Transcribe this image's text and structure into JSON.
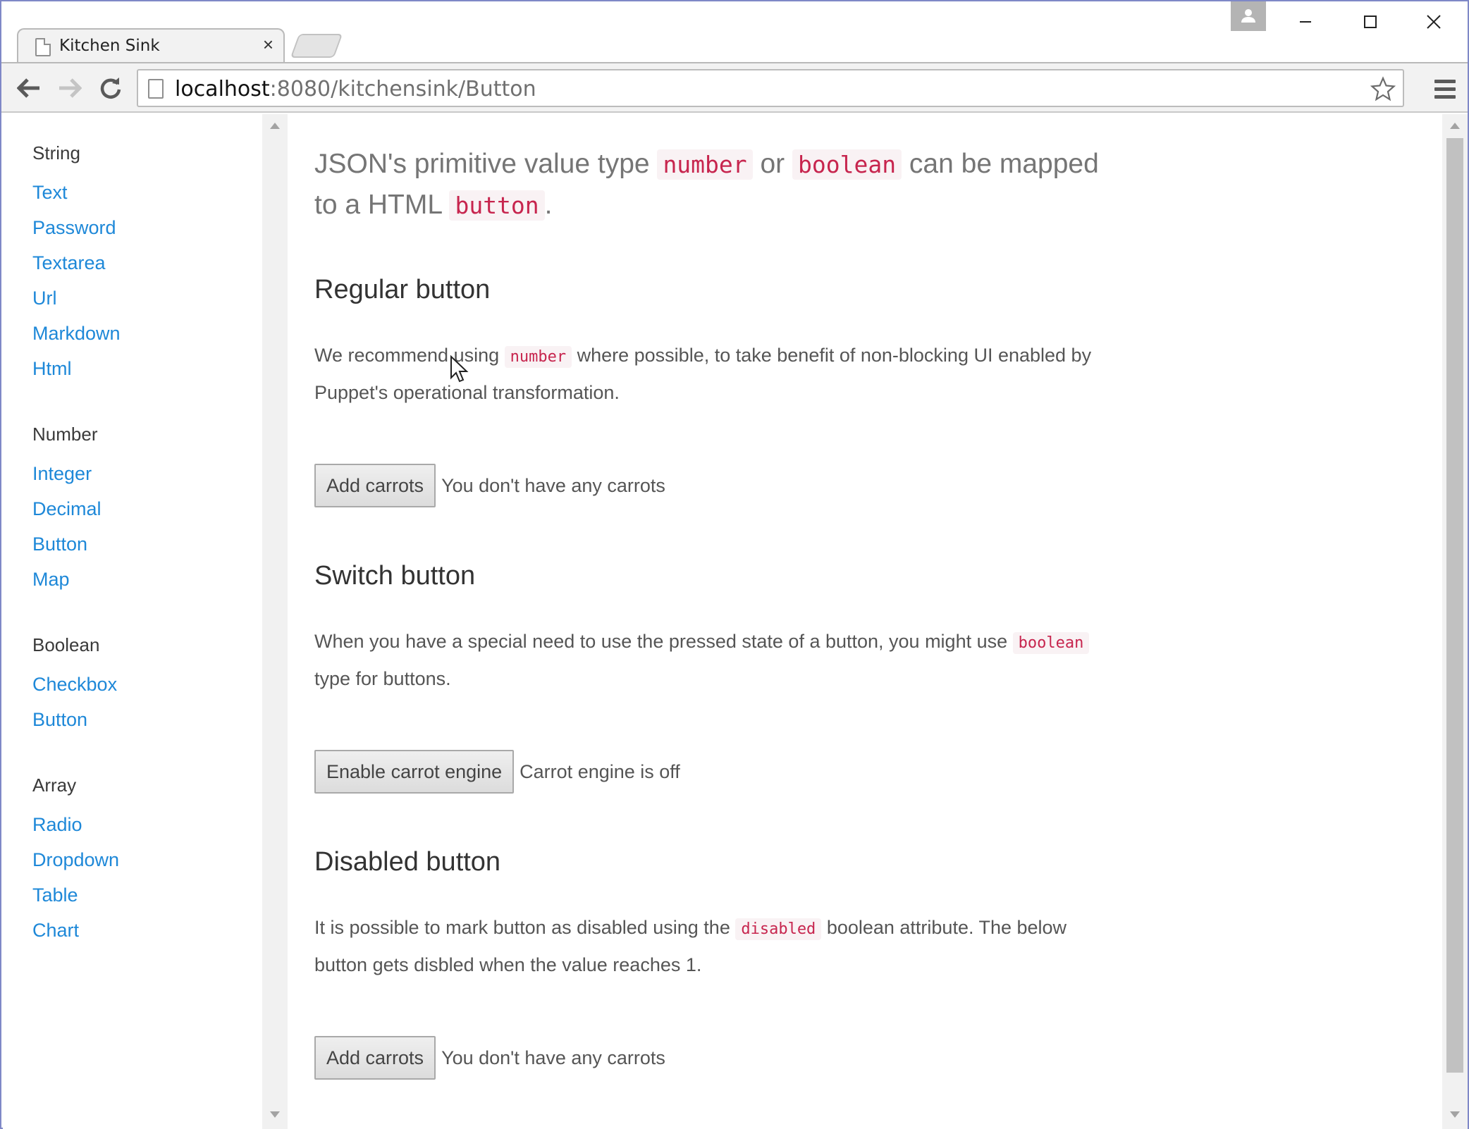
{
  "browser": {
    "tab_title": "Kitchen Sink",
    "tab_close": "×",
    "url_host": "localhost",
    "url_rest": ":8080/kitchensink/Button"
  },
  "sidebar": {
    "groups": [
      {
        "heading": "String",
        "items": [
          "Text",
          "Password",
          "Textarea",
          "Url",
          "Markdown",
          "Html"
        ]
      },
      {
        "heading": "Number",
        "items": [
          "Integer",
          "Decimal",
          "Button",
          "Map"
        ]
      },
      {
        "heading": "Boolean",
        "items": [
          "Checkbox",
          "Button"
        ]
      },
      {
        "heading": "Array",
        "items": [
          "Radio",
          "Dropdown",
          "Table",
          "Chart"
        ]
      }
    ]
  },
  "main": {
    "intro": {
      "t1": "JSON's primitive value type ",
      "c1": "number",
      "t2": " or ",
      "c2": "boolean",
      "t3": " can be mapped to a HTML ",
      "c3": "button",
      "t4": "."
    },
    "regular": {
      "title": "Regular button",
      "p1": "We recommend using ",
      "code": "number",
      "p2": " where possible, to take benefit of non-blocking UI enabled by Puppet's operational transformation.",
      "button": "Add carrots",
      "status": "You don't have any carrots"
    },
    "switch": {
      "title": "Switch button",
      "p1": "When you have a special need to use the pressed state of a button, you might use ",
      "code": "boolean",
      "p2": " type for buttons.",
      "button": "Enable carrot engine",
      "status": "Carrot engine is off"
    },
    "disabled": {
      "title": "Disabled button",
      "p1": "It is possible to mark button as disabled using the ",
      "code": "disabled",
      "p2": " boolean attribute. The below button gets disbled when the value reaches 1.",
      "button": "Add carrots",
      "status": "You don't have any carrots"
    }
  },
  "colors": {
    "link": "#1e88d8",
    "code_text": "#c7254e",
    "code_bg": "#f9f2f4"
  }
}
